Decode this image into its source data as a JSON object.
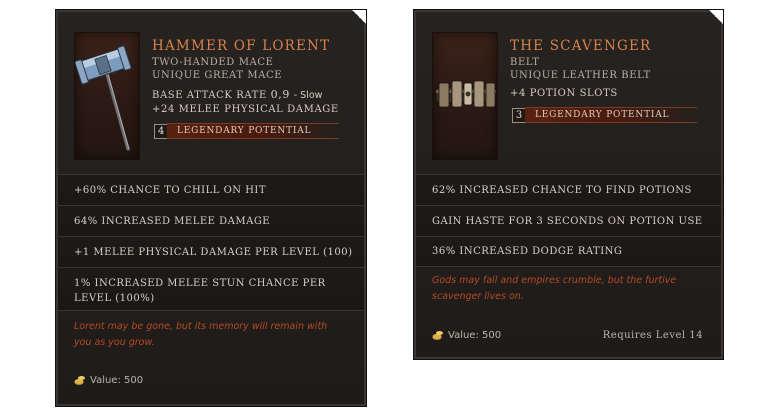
{
  "colors": {
    "unique_title": "#d8824a",
    "lore_text": "#b44a24",
    "legendary_bar": "#5a2110",
    "panel_bg": "#1f1c1a"
  },
  "items": [
    {
      "name": "Hammer of Lorent",
      "subtitles": [
        "Two-Handed Mace",
        "Unique Great Mace"
      ],
      "base_attack_label": "Base Attack Rate",
      "base_attack_value": "0,9",
      "base_attack_speed": "- Slow",
      "implicit": "+24 Melee Physical Damage",
      "legendary_potential": "4",
      "legendary_label": "Legendary Potential",
      "icon": "hammer-icon",
      "affixes": [
        "+60% Chance to Chill on Hit",
        "64% increased Melee Damage",
        "+1 melee physical damage per level (100)",
        "1% increased melee stun chance per level (100%)"
      ],
      "lore": "Lorent may be gone, but its memory will remain with you as you grow.",
      "value": "Value: 500"
    },
    {
      "name": "The Scavenger",
      "subtitles": [
        "Belt",
        "Unique Leather Belt"
      ],
      "implicit": "+4 Potion Slots",
      "legendary_potential": "3",
      "legendary_label": "Legendary Potential",
      "icon": "belt-icon",
      "affixes": [
        "62% increased Chance to Find Potions",
        "Gain Haste for 3 Seconds on Potion Use",
        "36% increased Dodge Rating"
      ],
      "lore": "Gods may fall and empires crumble, but the furtive scavenger lives on.",
      "value": "Value: 500",
      "requirement": "Requires Level 14"
    }
  ]
}
